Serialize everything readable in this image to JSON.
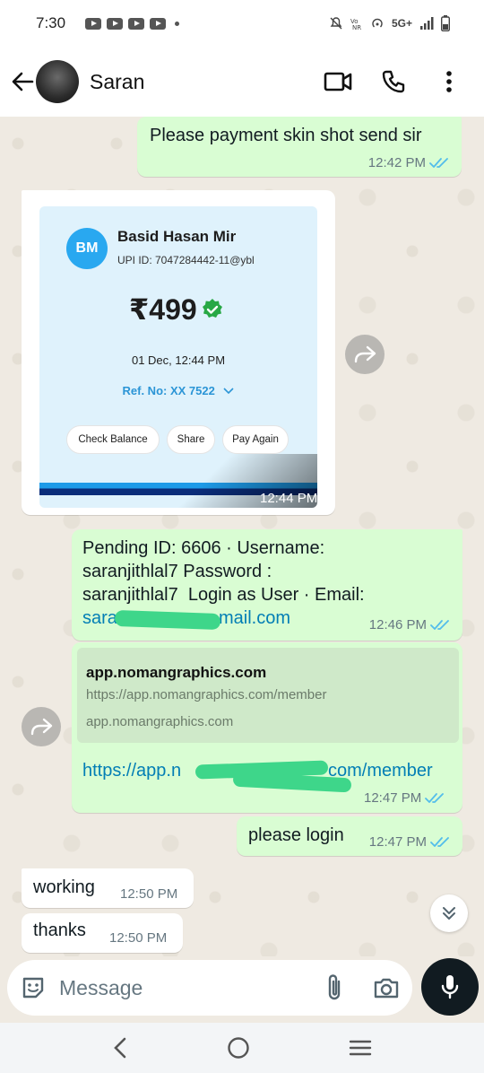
{
  "status_bar": {
    "time": "7:30",
    "network": "5G+"
  },
  "header": {
    "contact_name": "Saran"
  },
  "messages": [
    {
      "text": "Please payment skin shot send sir",
      "time": "12:42 PM"
    },
    {
      "payment": {
        "initials": "BM",
        "payee": "Basid Hasan Mir",
        "upi": "UPI ID: 7047284442-11@ybl",
        "amount": "₹499",
        "date": "01 Dec, 12:44 PM",
        "ref": "Ref. No: XX 7522",
        "buttons": [
          "Check Balance",
          "Share",
          "Pay Again"
        ]
      },
      "time": "12:44 PM"
    },
    {
      "lines": [
        "Pending ID: 6606 · Username:",
        "saranjithlal7 Password :",
        "saranjithlal7  Login as User · Email:"
      ],
      "email_start": "sara",
      "email_end": "mail.com",
      "time": "12:46 PM"
    },
    {
      "preview_title": "app.nomangraphics.com",
      "preview_url": "https://app.nomangraphics.com/member",
      "preview_domain": "app.nomangraphics.com",
      "link_start": "https://app.n",
      "link_end": "com/member",
      "time": "12:47 PM"
    },
    {
      "text": "please login",
      "time": "12:47 PM"
    },
    {
      "text": "working",
      "time": "12:50 PM"
    },
    {
      "text": "thanks",
      "time": "12:50 PM"
    }
  ],
  "input": {
    "placeholder": "Message"
  },
  "colors": {
    "outgoing": "#d9fdd3",
    "incoming": "#ffffff",
    "read_ticks": "#53bdeb",
    "link": "#027eb5"
  }
}
